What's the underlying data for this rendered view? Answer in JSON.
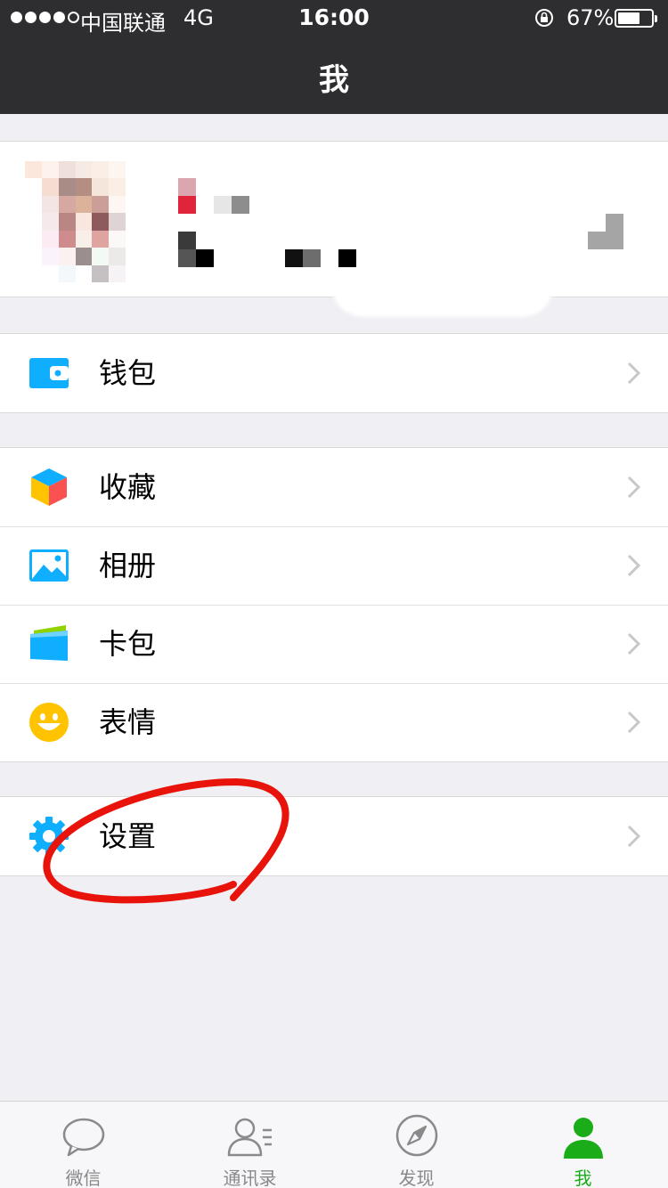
{
  "status_bar": {
    "carrier": "中国联通",
    "network": "4G",
    "time": "16:00",
    "battery": "67%",
    "battery_level": 0.67
  },
  "nav": {
    "title": "我"
  },
  "menu": {
    "wallet": "钱包",
    "favorites": "收藏",
    "album": "相册",
    "cards": "卡包",
    "stickers": "表情",
    "settings": "设置"
  },
  "tabbar": {
    "tabs": [
      {
        "label": "微信",
        "icon": "chat-bubble-icon",
        "active": false
      },
      {
        "label": "通讯录",
        "icon": "contacts-icon",
        "active": false
      },
      {
        "label": "发现",
        "icon": "compass-icon",
        "active": false
      },
      {
        "label": "我",
        "icon": "person-icon",
        "active": true
      }
    ]
  },
  "colors": {
    "nav_background": "#2e2e31",
    "page_background": "#efeff4",
    "accent_green": "#1aad19",
    "icon_blue": "#10aeff",
    "annotation_red": "#e8140c"
  }
}
